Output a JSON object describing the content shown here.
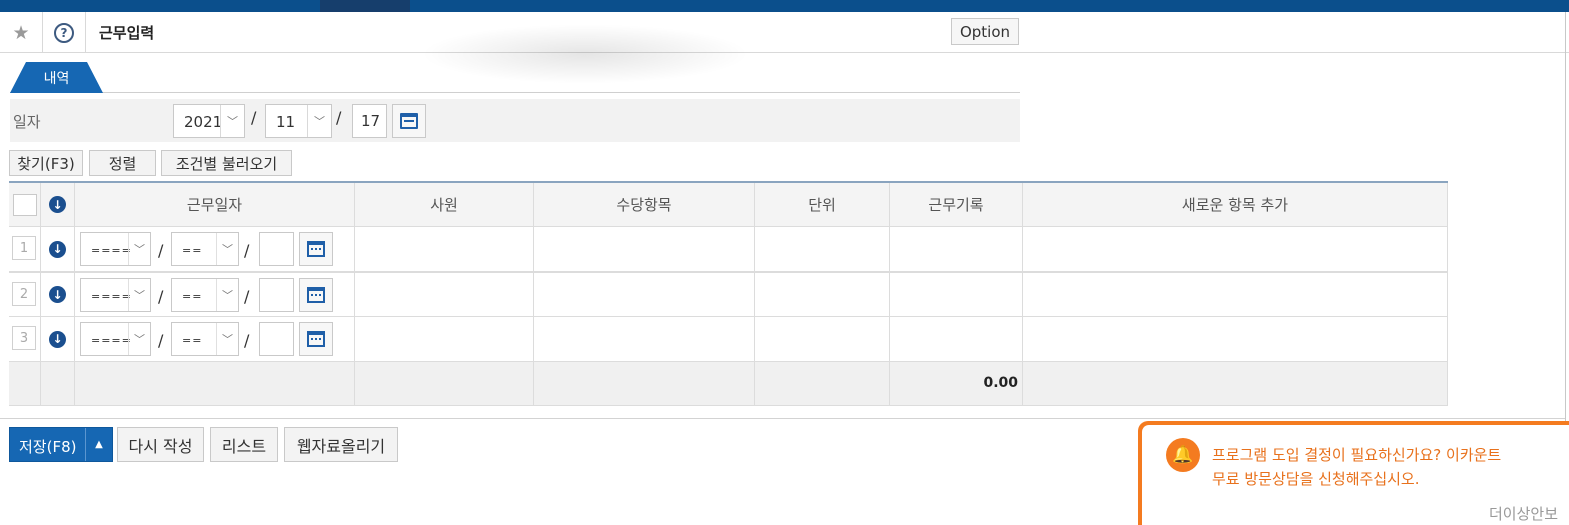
{
  "page": {
    "title": "근무입력",
    "option_label": "Option"
  },
  "tabs": [
    {
      "label": "내역"
    }
  ],
  "date_filter": {
    "label": "일자",
    "year": "2021",
    "month": "11",
    "day": "17",
    "separator": "/"
  },
  "toolbar": {
    "find_label": "찾기(F3)",
    "sort_label": "정렬",
    "load_label": "조건별 불러오기"
  },
  "table": {
    "columns": [
      "근무일자",
      "사원",
      "수당항목",
      "단위",
      "근무기록",
      "새로운 항목 추가"
    ],
    "rows": [
      {
        "num": "1",
        "year": "====",
        "month": "=="
      },
      {
        "num": "2",
        "year": "====",
        "month": "=="
      },
      {
        "num": "3",
        "year": "====",
        "month": "=="
      }
    ],
    "footer_total": "0.00"
  },
  "actions": {
    "save_label": "저장(F8)",
    "rewrite_label": "다시 작성",
    "list_label": "리스트",
    "upload_label": "웹자료올리기"
  },
  "notification": {
    "line1": "프로그램 도입 결정이 필요하신가요? 이카운트",
    "line2": "무료 방문상담을 신청해주십시오.",
    "dismiss_label": "더이상안보"
  },
  "colors": {
    "primary": "#1667b3",
    "topbar": "#0b4f8c",
    "notice": "#f47b20"
  }
}
